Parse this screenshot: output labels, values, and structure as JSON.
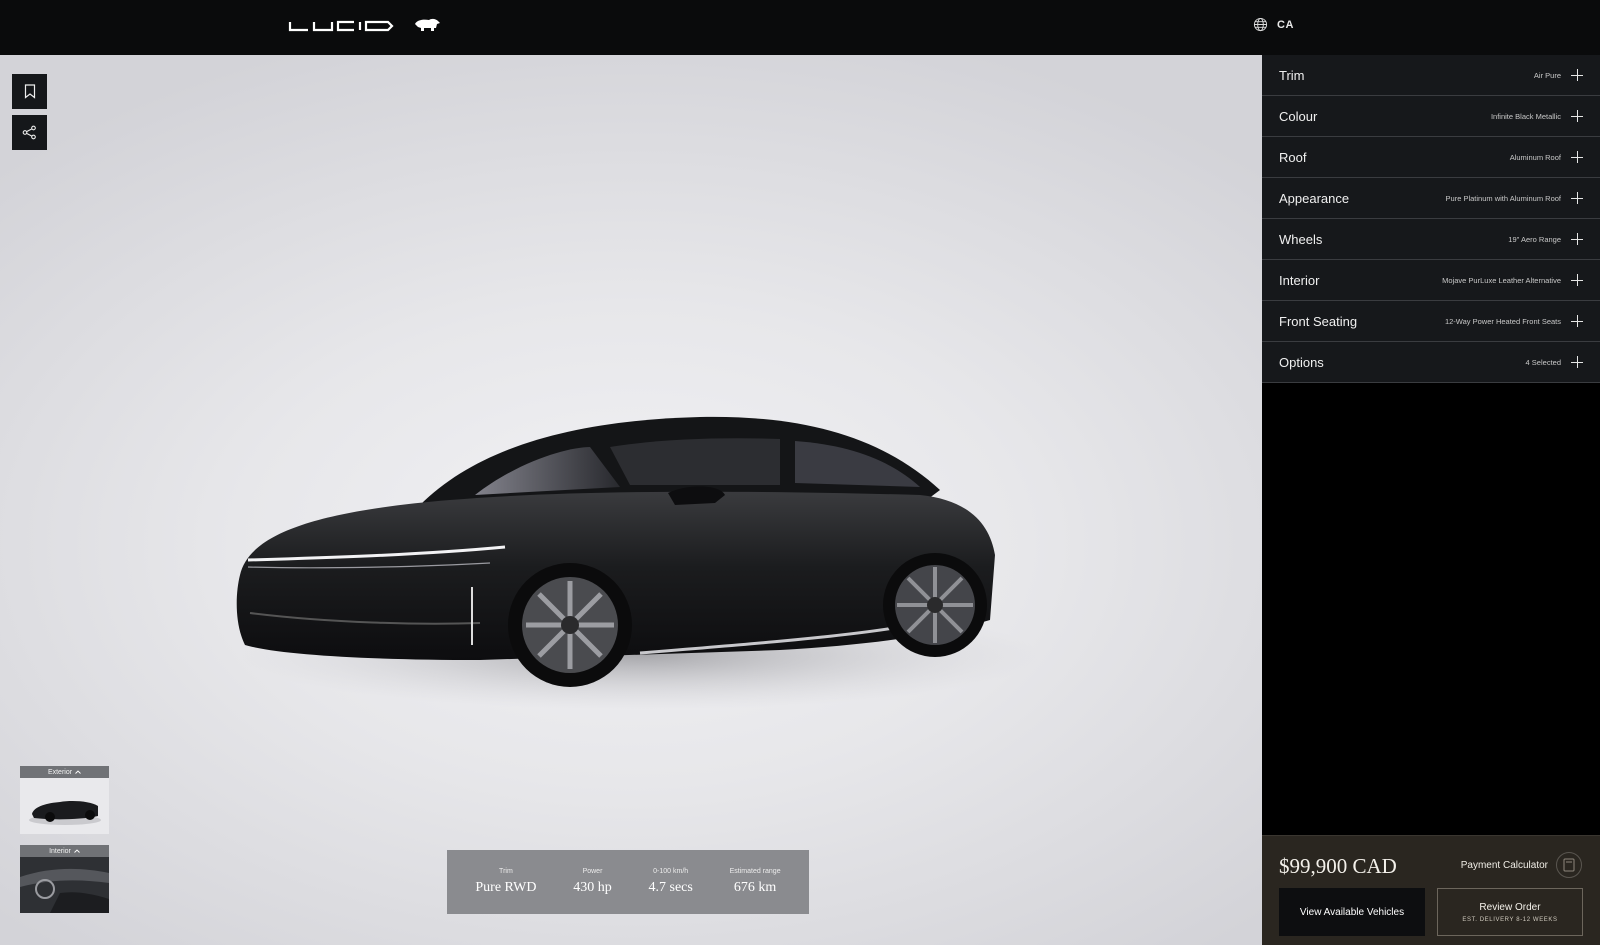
{
  "header": {
    "brand": "LUCID",
    "region": "CA"
  },
  "stage": {
    "bookmark_icon": "bookmark-icon",
    "share_icon": "share-icon",
    "thumbnails": [
      {
        "label": "Exterior"
      },
      {
        "label": "Interior"
      }
    ],
    "specs": [
      {
        "key": "Trim",
        "value": "Pure RWD"
      },
      {
        "key": "Power",
        "value": "430 hp"
      },
      {
        "key": "0-100 km/h",
        "value": "4.7 secs"
      },
      {
        "key": "Estimated range",
        "value": "676 km"
      }
    ]
  },
  "sidebar": {
    "options": [
      {
        "name": "Trim",
        "value": "Air Pure"
      },
      {
        "name": "Colour",
        "value": "Infinite Black Metallic"
      },
      {
        "name": "Roof",
        "value": "Aluminum Roof"
      },
      {
        "name": "Appearance",
        "value": "Pure Platinum with Aluminum Roof"
      },
      {
        "name": "Wheels",
        "value": "19\" Aero Range"
      },
      {
        "name": "Interior",
        "value": "Mojave PurLuxe Leather Alternative"
      },
      {
        "name": "Front Seating",
        "value": "12-Way Power Heated Front Seats"
      },
      {
        "name": "Options",
        "value": "4 Selected"
      }
    ]
  },
  "footer": {
    "price": "$99,900 CAD",
    "payment_calculator": "Payment Calculator",
    "view_available": "View Available Vehicles",
    "review_order": "Review Order",
    "delivery": "EST. DELIVERY 8-12 WEEKS"
  },
  "colors": {
    "header_bg": "#0a0b0c",
    "sidebar_row_bg": "#16181b",
    "footer_bg": "#2a2620",
    "spec_bar_bg": "#8a8b8f"
  }
}
